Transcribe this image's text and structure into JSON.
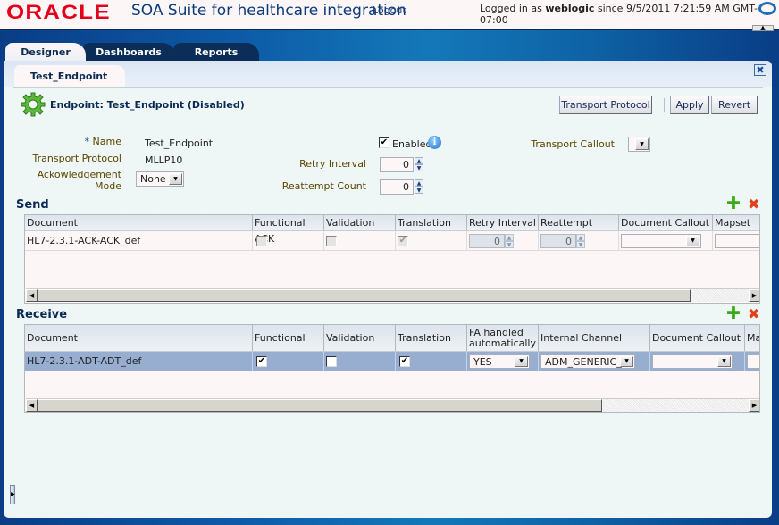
{
  "header": {
    "brand": "ORACLE",
    "app_title": "SOA Suite for healthcare integration",
    "logout_label": "Logout",
    "login_prefix": "Logged in as",
    "username": "weblogic",
    "login_suffix": "since 9/5/2011 7:21:59 AM GMT-07:00"
  },
  "main_tabs": [
    {
      "label": "Designer",
      "active": true
    },
    {
      "label": "Dashboards",
      "active": false
    },
    {
      "label": "Reports",
      "active": false
    }
  ],
  "subtab": {
    "label": "Test_Endpoint"
  },
  "endpoint": {
    "title": "Endpoint: Test_Endpoint (Disabled)",
    "buttons": {
      "transport_protocol": "Transport Protocol",
      "apply": "Apply",
      "revert": "Revert"
    },
    "form": {
      "name_required_marker": "*",
      "name_label": "Name",
      "name_value": "Test_Endpoint",
      "transport_protocol_label": "Transport Protocol",
      "transport_protocol_value": "MLLP10",
      "ack_mode_label_line1": "Ackowledgement",
      "ack_mode_label_line2": "Mode",
      "ack_mode_value": "None",
      "enabled_label": "Enabled",
      "enabled_checked": true,
      "retry_interval_label": "Retry Interval",
      "retry_interval_value": "0",
      "reattempt_count_label": "Reattempt Count",
      "reattempt_count_value": "0",
      "transport_callout_label": "Transport Callout",
      "transport_callout_value": ""
    }
  },
  "send": {
    "title": "Send",
    "columns": [
      "Document",
      "Functional ACK",
      "Validation",
      "Translation",
      "Retry Interval",
      "Reattempt Count",
      "Document Callout",
      "Mapset"
    ],
    "rows": [
      {
        "document": "HL7-2.3.1-ACK-ACK_def",
        "functional_ack": false,
        "validation": false,
        "translation": true,
        "retry_interval": "0",
        "reattempt_count": "0",
        "document_callout": "",
        "mapset": ""
      }
    ]
  },
  "receive": {
    "title": "Receive",
    "columns": [
      "Document",
      "Functional ACK",
      "Validation",
      "Translation",
      "FA handled automatically",
      "Internal Channel",
      "Document Callout",
      "Ma"
    ],
    "fa_col_line1": "FA handled",
    "fa_col_line2": "automatically",
    "rows": [
      {
        "document": "HL7-2.3.1-ADT-ADT_def",
        "functional_ack": true,
        "validation": false,
        "translation": true,
        "fa_handled": "YES",
        "internal_channel": "ADM_GENERIC_AI",
        "document_callout": "",
        "mapset": ""
      }
    ]
  },
  "icons": {
    "check": "✔",
    "down_arrow": "▼",
    "up_arrow": "▲",
    "left_arrow": "◀",
    "right_arrow": "▶",
    "plus": "✚",
    "cross": "✖",
    "close": "✖",
    "info": "i"
  },
  "colors": {
    "brand_red": "#e2001a",
    "title_blue": "#0a2a55",
    "label_olive": "#5a4600",
    "selected_row": "#97aed0",
    "add_green": "#3aa818",
    "delete_red": "#e2401a"
  }
}
